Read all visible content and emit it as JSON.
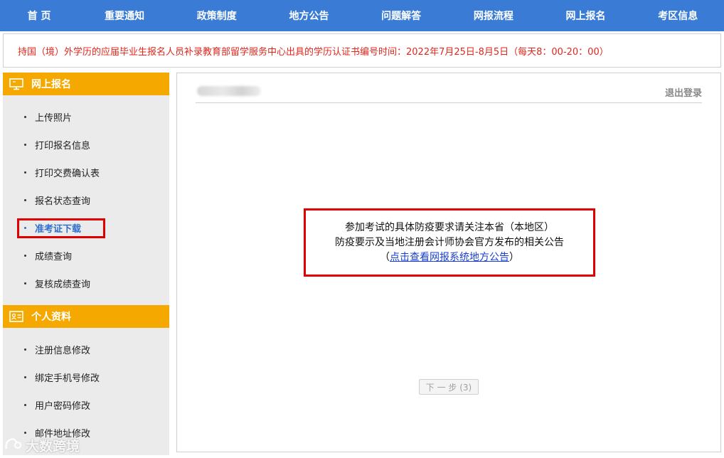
{
  "nav": [
    {
      "label": "首 页"
    },
    {
      "label": "重要通知"
    },
    {
      "label": "政策制度"
    },
    {
      "label": "地方公告"
    },
    {
      "label": "问题解答"
    },
    {
      "label": "网报流程"
    },
    {
      "label": "网上报名"
    },
    {
      "label": "考区信息"
    }
  ],
  "notice": {
    "text": "持国（境）外学历的应届毕业生报名人员补录教育部留学服务中心出具的学历认证书编号时间：2022年7月25日-8月5日（每天8：00-20：00）"
  },
  "sidebar": {
    "sections": [
      {
        "title": "网上报名",
        "icon": "monitor-icon",
        "items": [
          {
            "label": "上传照片"
          },
          {
            "label": "打印报名信息"
          },
          {
            "label": "打印交费确认表"
          },
          {
            "label": "报名状态查询"
          },
          {
            "label": "准考证下载"
          },
          {
            "label": "成绩查询"
          },
          {
            "label": "复核成绩查询"
          }
        ]
      },
      {
        "title": "个人资料",
        "icon": "id-card-icon",
        "items": [
          {
            "label": "注册信息修改"
          },
          {
            "label": "绑定手机号修改"
          },
          {
            "label": "用户密码修改"
          },
          {
            "label": "邮件地址修改"
          }
        ]
      }
    ]
  },
  "main": {
    "logout_label": "退出登录",
    "message_line1": "参加考试的具体防疫要求请关注本省（本地区）",
    "message_line2": "防疫要示及当地注册会计师协会官方发布的相关公告",
    "link_open": "（",
    "link_text": "点击查看网报系统地方公告",
    "link_close": "）",
    "next_button": "下 一 步 (3)"
  },
  "watermark": {
    "text": "大数跨境"
  },
  "colors": {
    "nav_bg": "#3a7bd5",
    "side_header": "#f5a900",
    "notice_text": "#e1261c",
    "highlight": "#e00000",
    "active_item": "#2f6fd0",
    "link": "#1a3fcc"
  }
}
